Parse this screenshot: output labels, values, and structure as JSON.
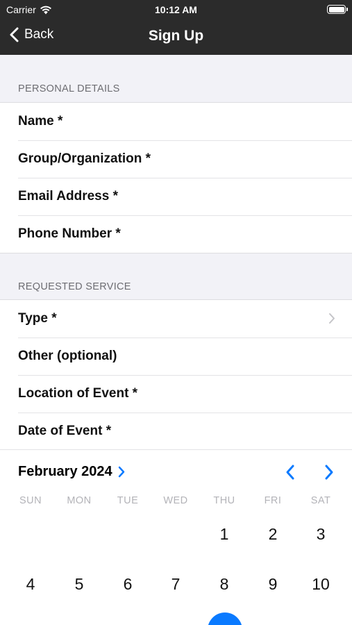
{
  "status": {
    "carrier": "Carrier",
    "time": "10:12 AM"
  },
  "nav": {
    "back_label": "Back",
    "title": "Sign Up"
  },
  "sections": {
    "personal": {
      "header": "PERSONAL DETAILS",
      "rows": [
        "Name *",
        "Group/Organization *",
        "Email Address *",
        "Phone Number *"
      ]
    },
    "service": {
      "header": "REQUESTED SERVICE",
      "rows": [
        "Type *",
        "Other (optional)",
        "Location of Event *",
        "Date of Event *"
      ]
    }
  },
  "calendar": {
    "month_label": "February 2024",
    "weekdays": [
      "SUN",
      "MON",
      "TUE",
      "WED",
      "THU",
      "FRI",
      "SAT"
    ],
    "week1": [
      "",
      "",
      "",
      "",
      "1",
      "2",
      "3"
    ],
    "week2": [
      "4",
      "5",
      "6",
      "7",
      "8",
      "9",
      "10"
    ]
  },
  "colors": {
    "accent": "#0a7aff",
    "navbar": "#2b2b2b",
    "background": "#f2f2f7"
  }
}
